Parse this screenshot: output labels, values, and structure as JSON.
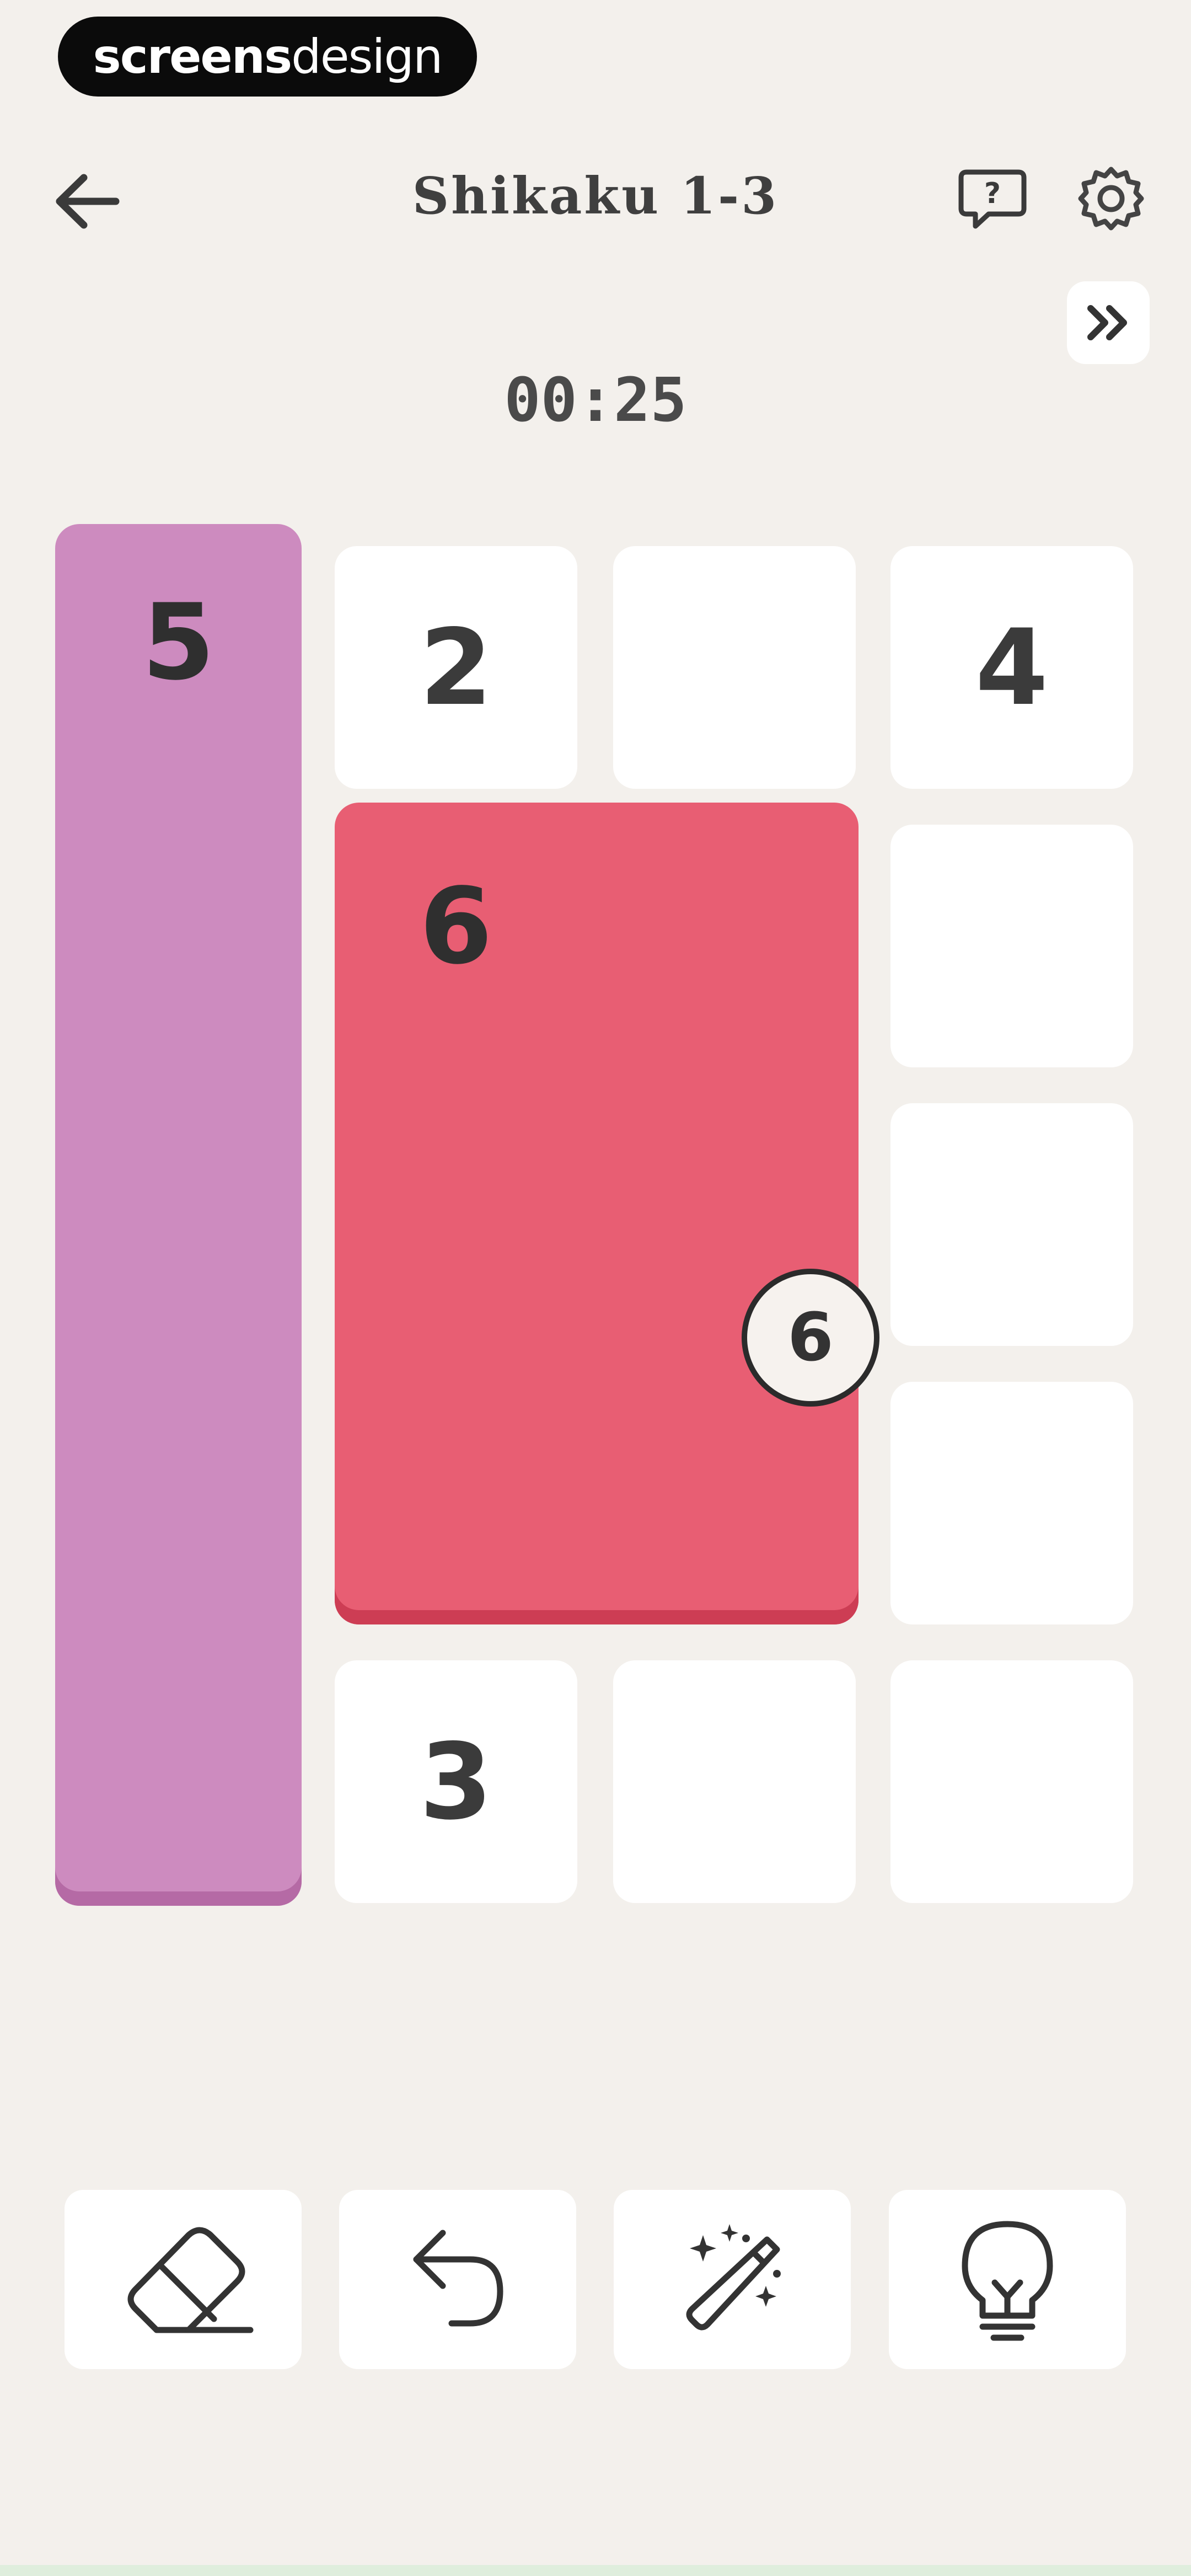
{
  "watermark": {
    "brand_bold": "screens",
    "brand_light": "design"
  },
  "header": {
    "title": "Shikaku 1-3",
    "back_icon": "arrow-left-icon",
    "help_icon": "help-bubble-icon",
    "settings_icon": "gear-icon",
    "skip_icon": "double-chevron-right-icon"
  },
  "timer": "00:25",
  "board": {
    "columns": 4,
    "rows": 5,
    "clues": [
      {
        "row": 0,
        "col": 0,
        "value": "5"
      },
      {
        "row": 0,
        "col": 1,
        "value": "2"
      },
      {
        "row": 0,
        "col": 3,
        "value": "4"
      },
      {
        "row": 1,
        "col": 1,
        "value": "6"
      },
      {
        "row": 4,
        "col": 1,
        "value": "3"
      }
    ],
    "regions": [
      {
        "clue": "5",
        "color": "#cd8bbf",
        "cells": "col 0, rows 0-4"
      },
      {
        "clue": "6",
        "color": "#e85e73",
        "cells": "cols 1-2, rows 1-3"
      }
    ],
    "cell_labels": {
      "r0c1": "2",
      "r0c2": "",
      "r0c3": "4",
      "r1c3": "",
      "r2c3": "",
      "r3c3": "",
      "r4c1": "3",
      "r4c2": "",
      "r4c3": ""
    },
    "region_labels": {
      "purple": "5",
      "red": "6"
    },
    "drag_indicator": "6"
  },
  "toolbar": [
    {
      "name": "eraser",
      "icon": "eraser-icon"
    },
    {
      "name": "undo",
      "icon": "undo-icon"
    },
    {
      "name": "auto-solve",
      "icon": "magic-wand-icon"
    },
    {
      "name": "hint",
      "icon": "lightbulb-icon"
    }
  ],
  "colors": {
    "background": "#f3f0ec",
    "cell": "#ffffff",
    "region_purple": "#cd8bbf",
    "region_red": "#e85e73"
  }
}
